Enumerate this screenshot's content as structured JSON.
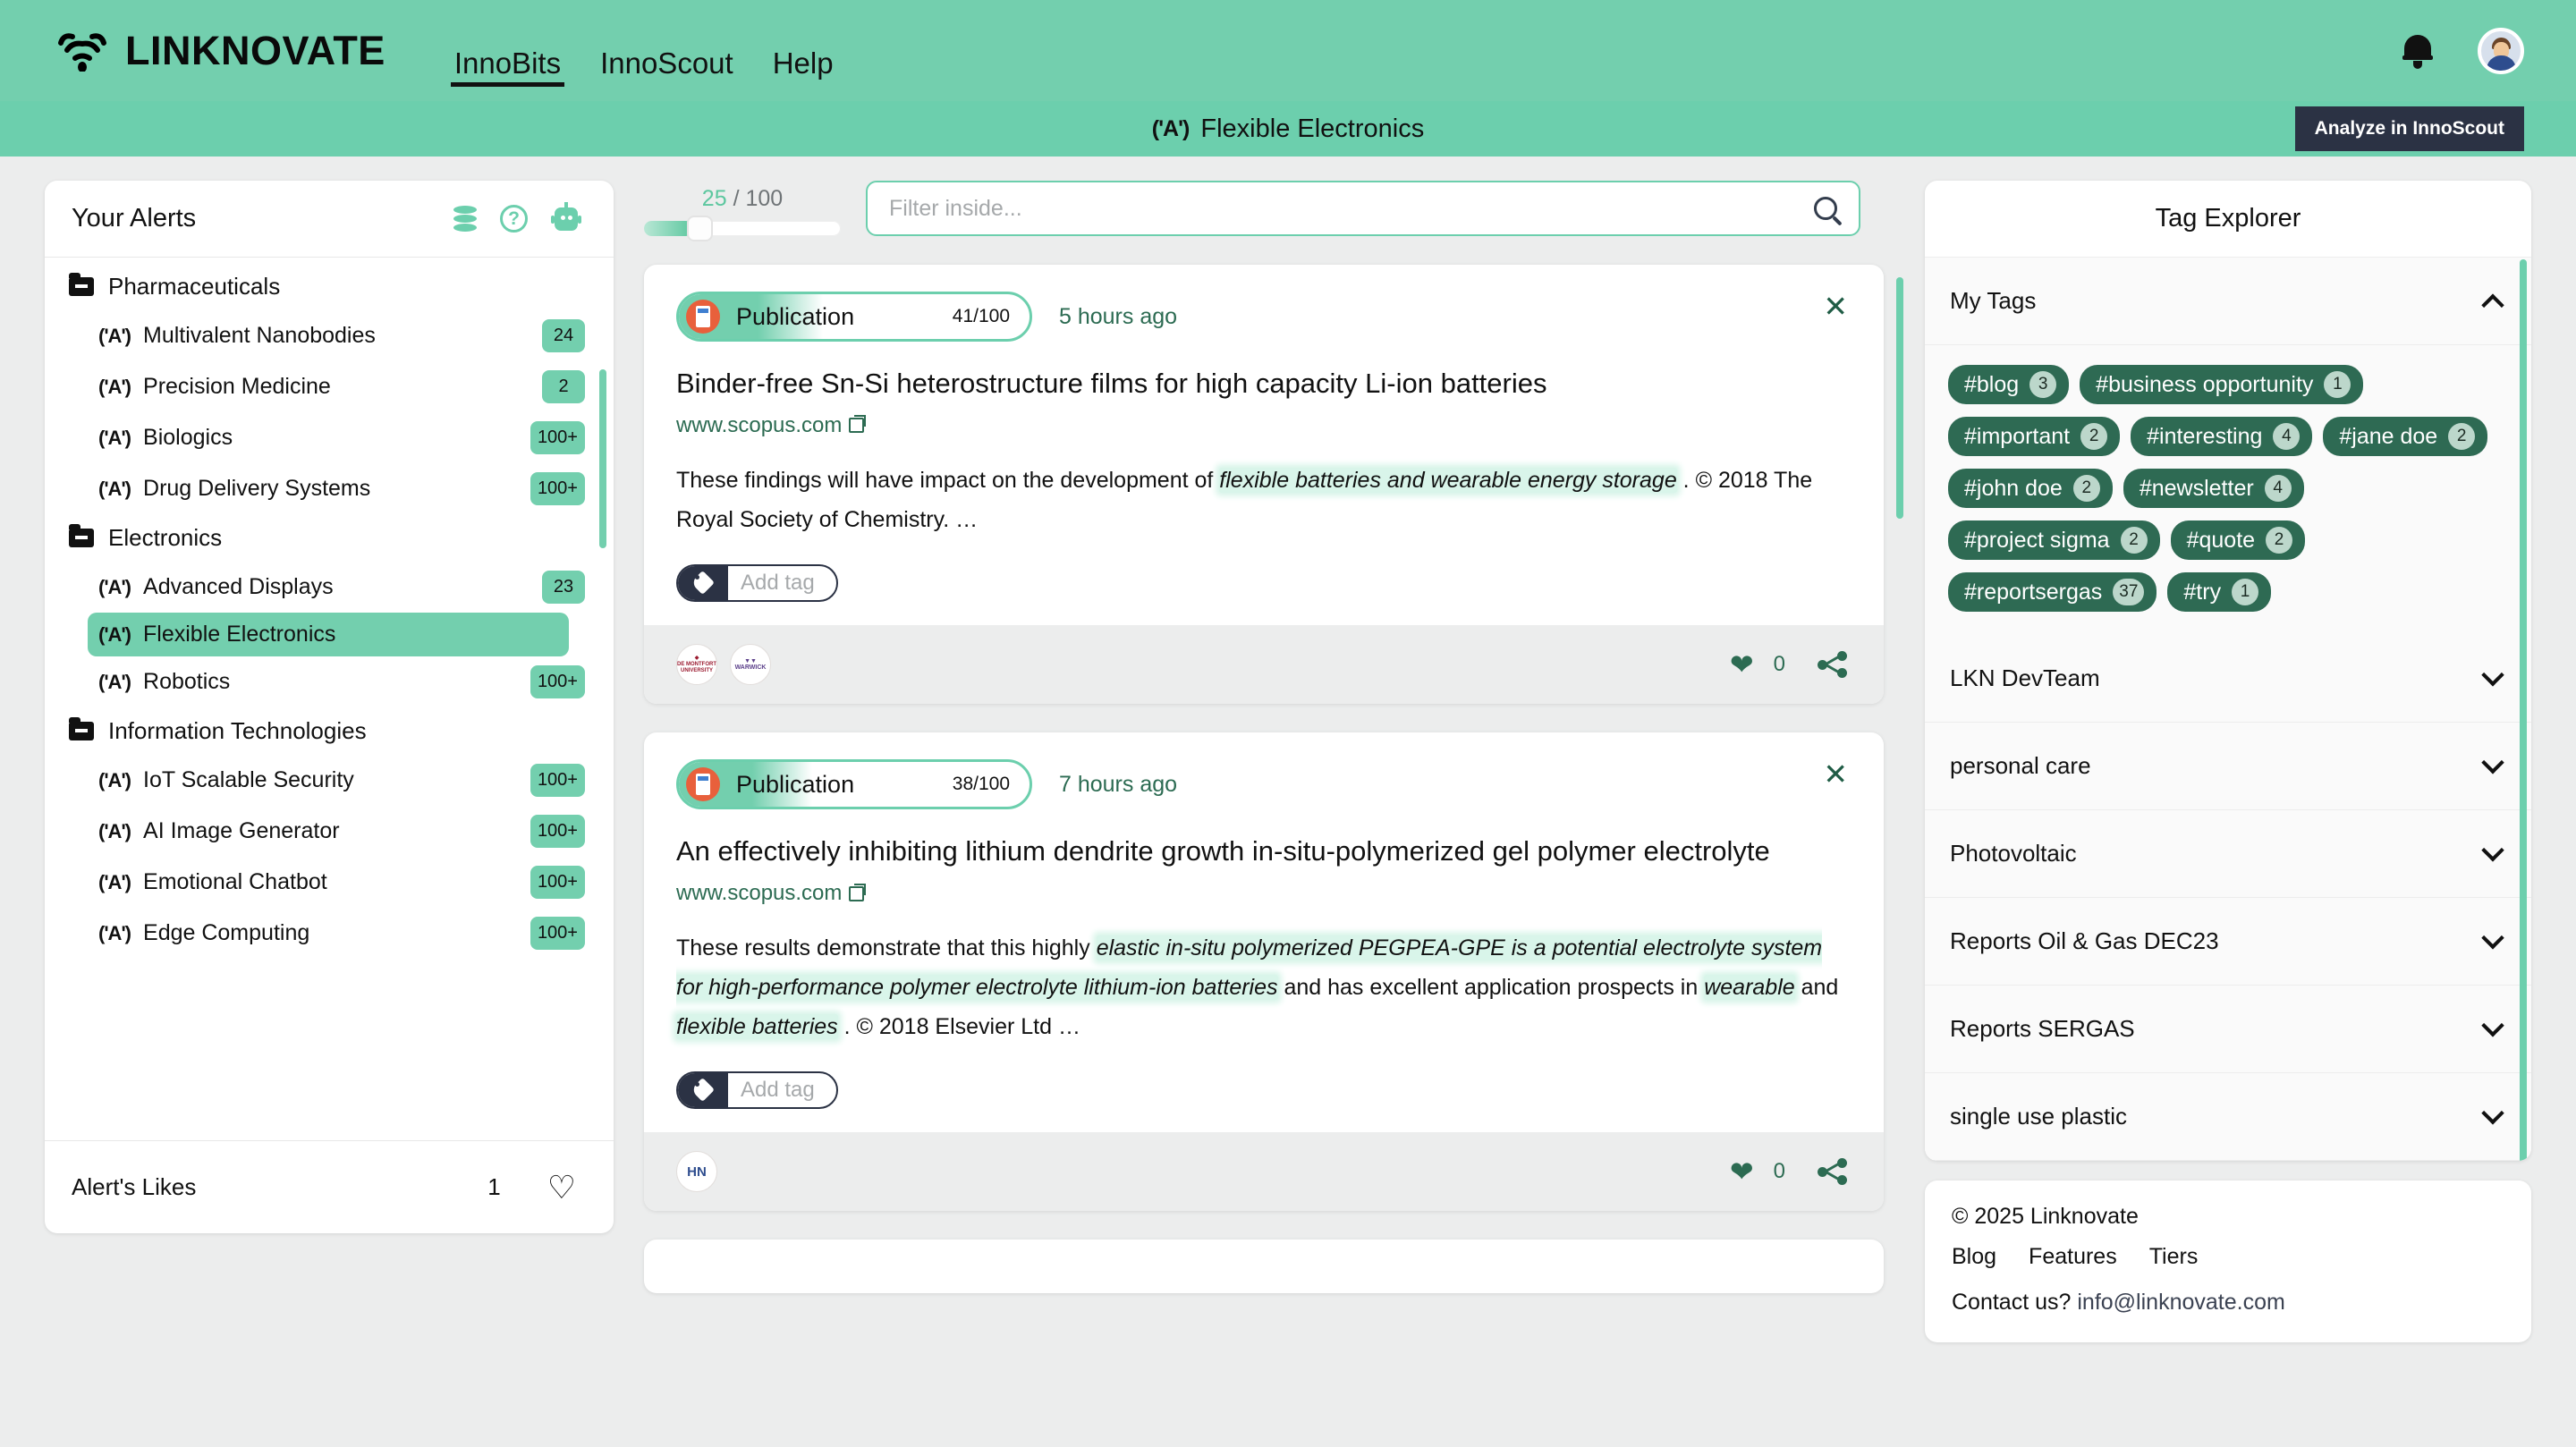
{
  "header": {
    "brand": "LINKNOVATE",
    "brand_icon": "wifi-signal-icon",
    "nav": [
      {
        "label": "InnoBits",
        "active": true
      },
      {
        "label": "InnoScout",
        "active": false
      },
      {
        "label": "Help",
        "active": false
      }
    ],
    "bell_icon": "notification-bell-icon",
    "avatar_icon": "user-avatar"
  },
  "alert_bar": {
    "icon": "antenna-icon",
    "title": "Flexible Electronics",
    "analyze_button": "Analyze in InnoScout"
  },
  "sidebar": {
    "title": "Your Alerts",
    "icons": [
      "database-icon",
      "help-circle-icon",
      "robot-icon"
    ],
    "tree": [
      {
        "type": "folder",
        "label": "Pharmaceuticals"
      },
      {
        "type": "alert",
        "label": "Multivalent Nanobodies",
        "count": "24",
        "selected": false
      },
      {
        "type": "alert",
        "label": "Precision Medicine",
        "count": "2",
        "selected": false
      },
      {
        "type": "alert",
        "label": "Biologics",
        "count": "100+",
        "selected": false
      },
      {
        "type": "alert",
        "label": "Drug Delivery Systems",
        "count": "100+",
        "selected": false
      },
      {
        "type": "folder",
        "label": "Electronics"
      },
      {
        "type": "alert",
        "label": "Advanced Displays",
        "count": "23",
        "selected": false
      },
      {
        "type": "alert",
        "label": "Flexible Electronics",
        "count": "",
        "selected": true
      },
      {
        "type": "alert",
        "label": "Robotics",
        "count": "100+",
        "selected": false
      },
      {
        "type": "folder",
        "label": "Information Technologies"
      },
      {
        "type": "alert",
        "label": "IoT Scalable Security",
        "count": "100+",
        "selected": false
      },
      {
        "type": "alert",
        "label": "AI Image Generator",
        "count": "100+",
        "selected": false
      },
      {
        "type": "alert",
        "label": "Emotional Chatbot",
        "count": "100+",
        "selected": false
      },
      {
        "type": "alert",
        "label": "Edge Computing",
        "count": "100+",
        "selected": false
      }
    ],
    "footer": {
      "label": "Alert's Likes",
      "value": "1",
      "heart_icon": "heart-outline-icon"
    }
  },
  "feed": {
    "slider": {
      "value": "25",
      "separator": "/",
      "max": "100",
      "percent": 25
    },
    "filter": {
      "placeholder": "Filter inside...",
      "value": "",
      "search_icon": "search-icon"
    },
    "cards": [
      {
        "type_label": "Publication",
        "type_icon": "publication-icon",
        "score": "41/100",
        "score_percent": 41,
        "time": "5 hours ago",
        "close_icon": "close-icon",
        "title": "Binder-free Sn-Si heterostructure films for high capacity Li-ion batteries",
        "source": "www.scopus.com",
        "source_icon": "external-link-icon",
        "abstract_parts": [
          {
            "text": "These findings will have impact on the development of ",
            "highlight": false
          },
          {
            "text": "flexible batteries and wearable energy storage",
            "highlight": true
          },
          {
            "text": " . © 2018 The Royal Society of Chemistry. …",
            "highlight": false
          }
        ],
        "add_tag_placeholder": "Add tag",
        "add_tag_icon": "tag-plus-icon",
        "logos": [
          "DE MONTFORT UNIVERSITY",
          "WARWICK"
        ],
        "likes": "0",
        "heart_icon": "heart-filled-icon",
        "share_icon": "share-icon"
      },
      {
        "type_label": "Publication",
        "type_icon": "publication-icon",
        "score": "38/100",
        "score_percent": 38,
        "time": "7 hours ago",
        "close_icon": "close-icon",
        "title": "An effectively inhibiting lithium dendrite growth in-situ-polymerized gel polymer electrolyte",
        "source": "www.scopus.com",
        "source_icon": "external-link-icon",
        "abstract_parts": [
          {
            "text": "These results demonstrate that this highly ",
            "highlight": false
          },
          {
            "text": "elastic in-situ polymerized PEGPEA-GPE is a potential electrolyte system for high-performance polymer electrolyte lithium-ion batteries",
            "highlight": true
          },
          {
            "text": " and has excellent application prospects in ",
            "highlight": false
          },
          {
            "text": "wearable",
            "highlight": true
          },
          {
            "text": " and ",
            "highlight": false
          },
          {
            "text": "flexible batteries",
            "highlight": true
          },
          {
            "text": " . © 2018 Elsevier Ltd …",
            "highlight": false
          }
        ],
        "add_tag_placeholder": "Add tag",
        "add_tag_icon": "tag-plus-icon",
        "logos": [
          "HN"
        ],
        "likes": "0",
        "heart_icon": "heart-filled-icon",
        "share_icon": "share-icon"
      }
    ]
  },
  "tag_explorer": {
    "title": "Tag Explorer",
    "my_tags": {
      "label": "My Tags",
      "expanded": true
    },
    "tags": [
      {
        "name": "#blog",
        "count": "3"
      },
      {
        "name": "#business opportunity",
        "count": "1"
      },
      {
        "name": "#important",
        "count": "2"
      },
      {
        "name": "#interesting",
        "count": "4"
      },
      {
        "name": "#jane doe",
        "count": "2"
      },
      {
        "name": "#john doe",
        "count": "2"
      },
      {
        "name": "#newsletter",
        "count": "4"
      },
      {
        "name": "#project sigma",
        "count": "2"
      },
      {
        "name": "#quote",
        "count": "2"
      },
      {
        "name": "#reportsergas",
        "count": "37"
      },
      {
        "name": "#try",
        "count": "1"
      }
    ],
    "groups": [
      {
        "label": "LKN DevTeam"
      },
      {
        "label": "personal care"
      },
      {
        "label": "Photovoltaic"
      },
      {
        "label": "Reports Oil & Gas DEC23"
      },
      {
        "label": "Reports SERGAS"
      },
      {
        "label": "single use plastic"
      }
    ]
  },
  "footer": {
    "copyright": "© 2025 Linknovate",
    "links": [
      "Blog",
      "Features",
      "Tiers"
    ],
    "contact_label": "Contact us?",
    "contact_email": "info@linknovate.com"
  },
  "colors": {
    "brand_green": "#73cfae",
    "accent_green": "#6ccfad",
    "dark_green": "#2e6a53",
    "navy": "#2b3244",
    "page_bg": "#eceded"
  }
}
